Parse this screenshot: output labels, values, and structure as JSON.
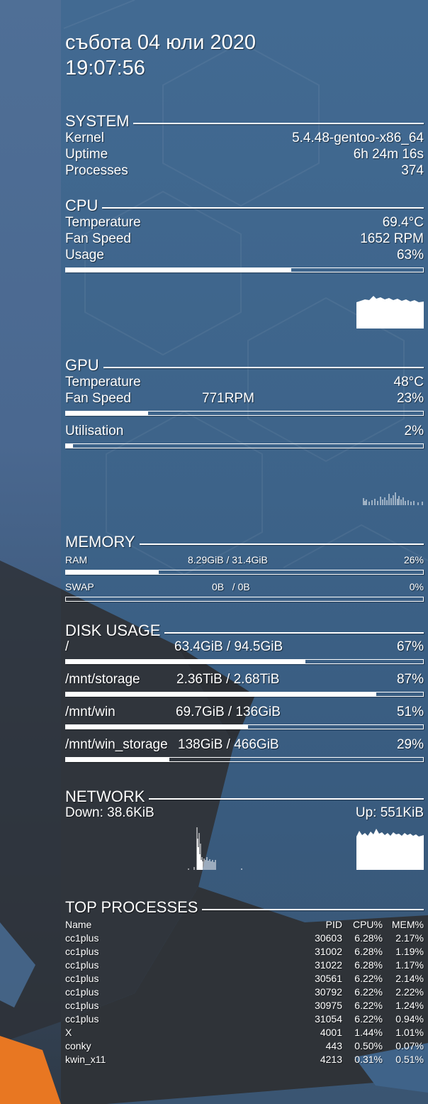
{
  "datetime": {
    "date": "събота 04 юли 2020",
    "time": "19:07:56"
  },
  "system": {
    "title": "SYSTEM",
    "rows": [
      {
        "label": "Kernel",
        "value": "5.4.48-gentoo-x86_64"
      },
      {
        "label": "Uptime",
        "value": "6h 24m 16s"
      },
      {
        "label": "Processes",
        "value": "374"
      }
    ]
  },
  "cpu": {
    "title": "CPU",
    "rows": [
      {
        "label": "Temperature",
        "value": "69.4°C"
      },
      {
        "label": "Fan Speed",
        "value": "1652 RPM"
      },
      {
        "label": "Usage",
        "value": "63%"
      }
    ],
    "usage_fraction": 0.63
  },
  "gpu": {
    "title": "GPU",
    "temperature_label": "Temperature",
    "temperature_value": "48°C",
    "fan_label": "Fan Speed",
    "fan_rpm": "771RPM",
    "fan_percent": "23%",
    "fan_fraction": 0.23,
    "util_label": "Utilisation",
    "util_percent": "2%",
    "util_fraction": 0.02
  },
  "memory": {
    "title": "MEMORY",
    "ram": {
      "label": "RAM",
      "used": "8.29GiB / 31.4GiB",
      "percent": "26%",
      "fraction": 0.26
    },
    "swap": {
      "label": "SWAP",
      "used": "0B   / 0B",
      "percent": "0%",
      "fraction": 0.0
    }
  },
  "disk": {
    "title": "DISK USAGE",
    "items": [
      {
        "mount": "/",
        "usage": "63.4GiB / 94.5GiB",
        "percent": "67%",
        "fraction": 0.67
      },
      {
        "mount": "/mnt/storage",
        "usage": "2.36TiB / 2.68TiB",
        "percent": "87%",
        "fraction": 0.87
      },
      {
        "mount": "/mnt/win",
        "usage": "69.7GiB / 136GiB",
        "percent": "51%",
        "fraction": 0.51
      },
      {
        "mount": "/mnt/win_storage",
        "usage": "138GiB / 466GiB",
        "percent": "29%",
        "fraction": 0.29
      }
    ]
  },
  "network": {
    "title": "NETWORK",
    "down": "Down: 38.6KiB",
    "up": "Up: 551KiB"
  },
  "processes": {
    "title": "TOP PROCESSES",
    "headers": {
      "name": "Name",
      "pid": "PID",
      "cpu": "CPU%",
      "mem": "MEM%"
    },
    "rows": [
      {
        "name": "cc1plus",
        "pid": "30603",
        "cpu": "6.28%",
        "mem": "2.17%"
      },
      {
        "name": "cc1plus",
        "pid": "31002",
        "cpu": "6.28%",
        "mem": "1.19%"
      },
      {
        "name": "cc1plus",
        "pid": "31022",
        "cpu": "6.28%",
        "mem": "1.17%"
      },
      {
        "name": "cc1plus",
        "pid": "30561",
        "cpu": "6.22%",
        "mem": "2.14%"
      },
      {
        "name": "cc1plus",
        "pid": "30792",
        "cpu": "6.22%",
        "mem": "2.22%"
      },
      {
        "name": "cc1plus",
        "pid": "30975",
        "cpu": "6.22%",
        "mem": "1.24%"
      },
      {
        "name": "cc1plus",
        "pid": "31054",
        "cpu": "6.22%",
        "mem": "0.94%"
      },
      {
        "name": "X",
        "pid": "4001",
        "cpu": "1.44%",
        "mem": "1.01%"
      },
      {
        "name": "conky",
        "pid": "443",
        "cpu": "0.50%",
        "mem": "0.07%"
      },
      {
        "name": "kwin_x11",
        "pid": "4213",
        "cpu": "0.31%",
        "mem": "0.51%"
      }
    ]
  },
  "colors": {
    "wallpaper_blue": "#3d6389",
    "wallpaper_dark": "#2f353c",
    "accent_orange": "#e87722",
    "text": "#ffffff"
  }
}
